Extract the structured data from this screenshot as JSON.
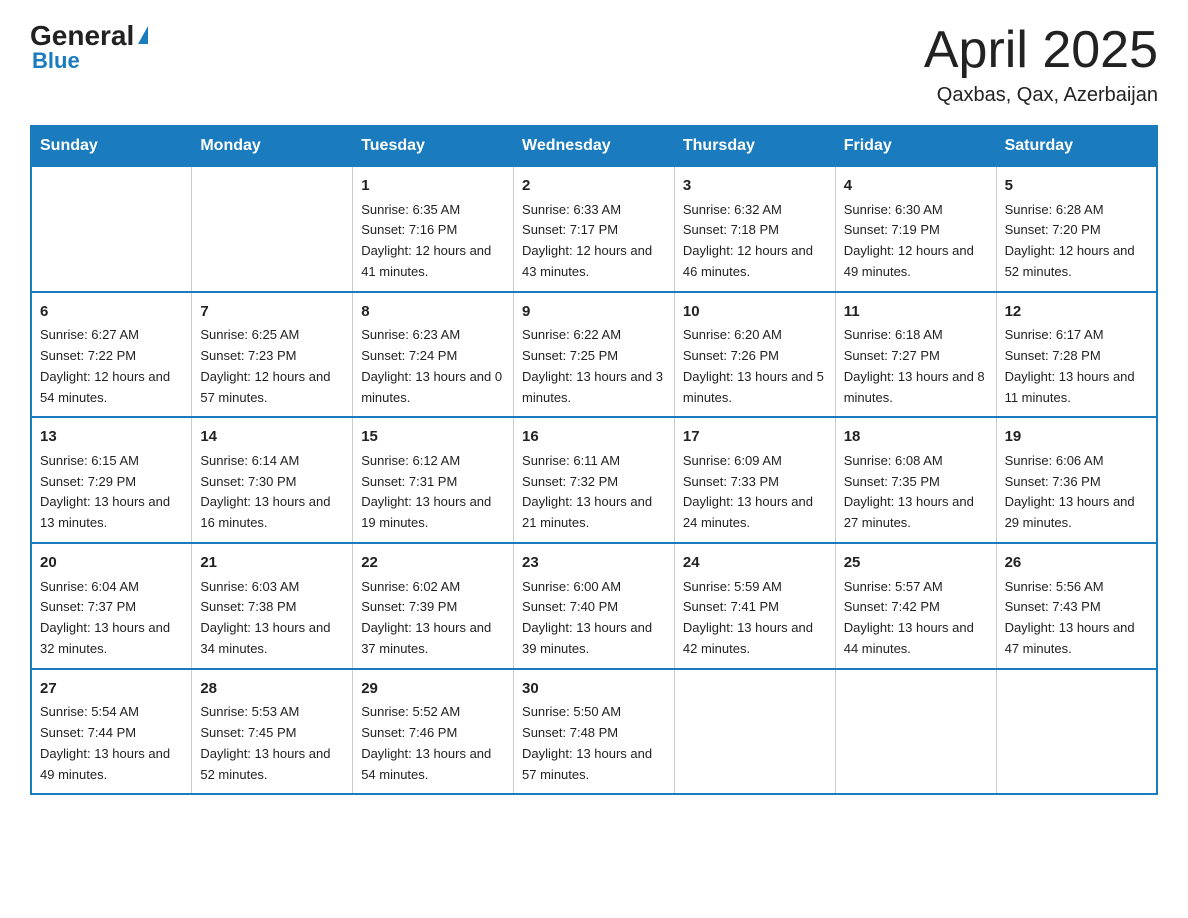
{
  "header": {
    "logo_general": "General",
    "logo_blue": "Blue",
    "month_title": "April 2025",
    "location": "Qaxbas, Qax, Azerbaijan"
  },
  "weekdays": [
    "Sunday",
    "Monday",
    "Tuesday",
    "Wednesday",
    "Thursday",
    "Friday",
    "Saturday"
  ],
  "weeks": [
    [
      {
        "day": "",
        "sunrise": "",
        "sunset": "",
        "daylight": ""
      },
      {
        "day": "",
        "sunrise": "",
        "sunset": "",
        "daylight": ""
      },
      {
        "day": "1",
        "sunrise": "Sunrise: 6:35 AM",
        "sunset": "Sunset: 7:16 PM",
        "daylight": "Daylight: 12 hours and 41 minutes."
      },
      {
        "day": "2",
        "sunrise": "Sunrise: 6:33 AM",
        "sunset": "Sunset: 7:17 PM",
        "daylight": "Daylight: 12 hours and 43 minutes."
      },
      {
        "day": "3",
        "sunrise": "Sunrise: 6:32 AM",
        "sunset": "Sunset: 7:18 PM",
        "daylight": "Daylight: 12 hours and 46 minutes."
      },
      {
        "day": "4",
        "sunrise": "Sunrise: 6:30 AM",
        "sunset": "Sunset: 7:19 PM",
        "daylight": "Daylight: 12 hours and 49 minutes."
      },
      {
        "day": "5",
        "sunrise": "Sunrise: 6:28 AM",
        "sunset": "Sunset: 7:20 PM",
        "daylight": "Daylight: 12 hours and 52 minutes."
      }
    ],
    [
      {
        "day": "6",
        "sunrise": "Sunrise: 6:27 AM",
        "sunset": "Sunset: 7:22 PM",
        "daylight": "Daylight: 12 hours and 54 minutes."
      },
      {
        "day": "7",
        "sunrise": "Sunrise: 6:25 AM",
        "sunset": "Sunset: 7:23 PM",
        "daylight": "Daylight: 12 hours and 57 minutes."
      },
      {
        "day": "8",
        "sunrise": "Sunrise: 6:23 AM",
        "sunset": "Sunset: 7:24 PM",
        "daylight": "Daylight: 13 hours and 0 minutes."
      },
      {
        "day": "9",
        "sunrise": "Sunrise: 6:22 AM",
        "sunset": "Sunset: 7:25 PM",
        "daylight": "Daylight: 13 hours and 3 minutes."
      },
      {
        "day": "10",
        "sunrise": "Sunrise: 6:20 AM",
        "sunset": "Sunset: 7:26 PM",
        "daylight": "Daylight: 13 hours and 5 minutes."
      },
      {
        "day": "11",
        "sunrise": "Sunrise: 6:18 AM",
        "sunset": "Sunset: 7:27 PM",
        "daylight": "Daylight: 13 hours and 8 minutes."
      },
      {
        "day": "12",
        "sunrise": "Sunrise: 6:17 AM",
        "sunset": "Sunset: 7:28 PM",
        "daylight": "Daylight: 13 hours and 11 minutes."
      }
    ],
    [
      {
        "day": "13",
        "sunrise": "Sunrise: 6:15 AM",
        "sunset": "Sunset: 7:29 PM",
        "daylight": "Daylight: 13 hours and 13 minutes."
      },
      {
        "day": "14",
        "sunrise": "Sunrise: 6:14 AM",
        "sunset": "Sunset: 7:30 PM",
        "daylight": "Daylight: 13 hours and 16 minutes."
      },
      {
        "day": "15",
        "sunrise": "Sunrise: 6:12 AM",
        "sunset": "Sunset: 7:31 PM",
        "daylight": "Daylight: 13 hours and 19 minutes."
      },
      {
        "day": "16",
        "sunrise": "Sunrise: 6:11 AM",
        "sunset": "Sunset: 7:32 PM",
        "daylight": "Daylight: 13 hours and 21 minutes."
      },
      {
        "day": "17",
        "sunrise": "Sunrise: 6:09 AM",
        "sunset": "Sunset: 7:33 PM",
        "daylight": "Daylight: 13 hours and 24 minutes."
      },
      {
        "day": "18",
        "sunrise": "Sunrise: 6:08 AM",
        "sunset": "Sunset: 7:35 PM",
        "daylight": "Daylight: 13 hours and 27 minutes."
      },
      {
        "day": "19",
        "sunrise": "Sunrise: 6:06 AM",
        "sunset": "Sunset: 7:36 PM",
        "daylight": "Daylight: 13 hours and 29 minutes."
      }
    ],
    [
      {
        "day": "20",
        "sunrise": "Sunrise: 6:04 AM",
        "sunset": "Sunset: 7:37 PM",
        "daylight": "Daylight: 13 hours and 32 minutes."
      },
      {
        "day": "21",
        "sunrise": "Sunrise: 6:03 AM",
        "sunset": "Sunset: 7:38 PM",
        "daylight": "Daylight: 13 hours and 34 minutes."
      },
      {
        "day": "22",
        "sunrise": "Sunrise: 6:02 AM",
        "sunset": "Sunset: 7:39 PM",
        "daylight": "Daylight: 13 hours and 37 minutes."
      },
      {
        "day": "23",
        "sunrise": "Sunrise: 6:00 AM",
        "sunset": "Sunset: 7:40 PM",
        "daylight": "Daylight: 13 hours and 39 minutes."
      },
      {
        "day": "24",
        "sunrise": "Sunrise: 5:59 AM",
        "sunset": "Sunset: 7:41 PM",
        "daylight": "Daylight: 13 hours and 42 minutes."
      },
      {
        "day": "25",
        "sunrise": "Sunrise: 5:57 AM",
        "sunset": "Sunset: 7:42 PM",
        "daylight": "Daylight: 13 hours and 44 minutes."
      },
      {
        "day": "26",
        "sunrise": "Sunrise: 5:56 AM",
        "sunset": "Sunset: 7:43 PM",
        "daylight": "Daylight: 13 hours and 47 minutes."
      }
    ],
    [
      {
        "day": "27",
        "sunrise": "Sunrise: 5:54 AM",
        "sunset": "Sunset: 7:44 PM",
        "daylight": "Daylight: 13 hours and 49 minutes."
      },
      {
        "day": "28",
        "sunrise": "Sunrise: 5:53 AM",
        "sunset": "Sunset: 7:45 PM",
        "daylight": "Daylight: 13 hours and 52 minutes."
      },
      {
        "day": "29",
        "sunrise": "Sunrise: 5:52 AM",
        "sunset": "Sunset: 7:46 PM",
        "daylight": "Daylight: 13 hours and 54 minutes."
      },
      {
        "day": "30",
        "sunrise": "Sunrise: 5:50 AM",
        "sunset": "Sunset: 7:48 PM",
        "daylight": "Daylight: 13 hours and 57 minutes."
      },
      {
        "day": "",
        "sunrise": "",
        "sunset": "",
        "daylight": ""
      },
      {
        "day": "",
        "sunrise": "",
        "sunset": "",
        "daylight": ""
      },
      {
        "day": "",
        "sunrise": "",
        "sunset": "",
        "daylight": ""
      }
    ]
  ]
}
